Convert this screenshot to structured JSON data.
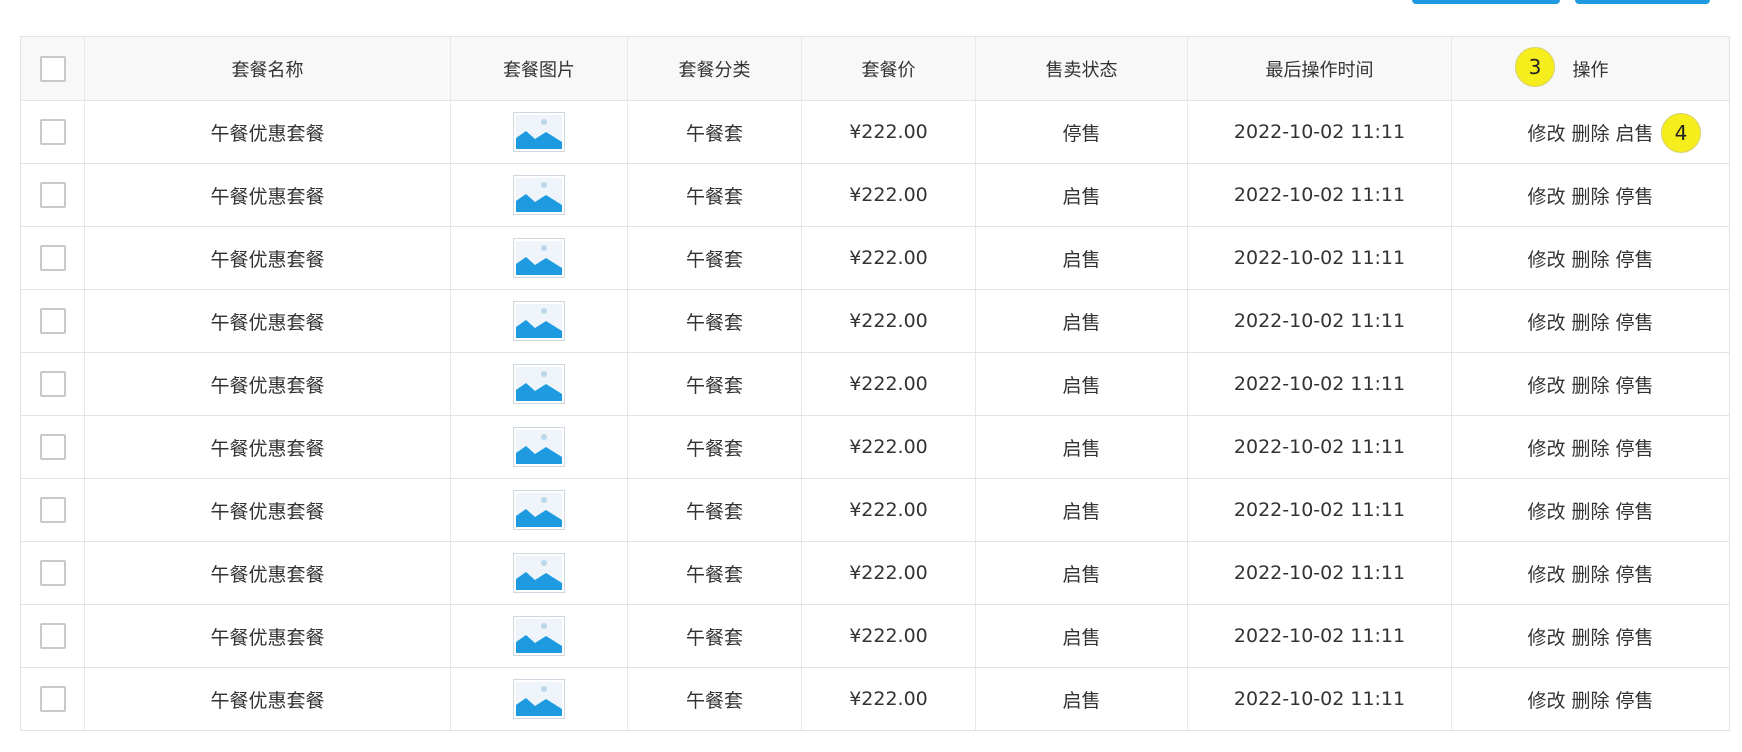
{
  "table": {
    "headers": {
      "name": "套餐名称",
      "image": "套餐图片",
      "category": "套餐分类",
      "price": "套餐价",
      "status": "售卖状态",
      "updated": "最后操作时间",
      "actions": "操作"
    },
    "rows": [
      {
        "name": "午餐优惠套餐",
        "category": "午餐套",
        "price": "¥222.00",
        "status": "停售",
        "updated": "2022-10-02 11:11",
        "edit": "修改",
        "delete": "删除",
        "toggle": "启售"
      },
      {
        "name": "午餐优惠套餐",
        "category": "午餐套",
        "price": "¥222.00",
        "status": "启售",
        "updated": "2022-10-02 11:11",
        "edit": "修改",
        "delete": "删除",
        "toggle": "停售"
      },
      {
        "name": "午餐优惠套餐",
        "category": "午餐套",
        "price": "¥222.00",
        "status": "启售",
        "updated": "2022-10-02 11:11",
        "edit": "修改",
        "delete": "删除",
        "toggle": "停售"
      },
      {
        "name": "午餐优惠套餐",
        "category": "午餐套",
        "price": "¥222.00",
        "status": "启售",
        "updated": "2022-10-02 11:11",
        "edit": "修改",
        "delete": "删除",
        "toggle": "停售"
      },
      {
        "name": "午餐优惠套餐",
        "category": "午餐套",
        "price": "¥222.00",
        "status": "启售",
        "updated": "2022-10-02 11:11",
        "edit": "修改",
        "delete": "删除",
        "toggle": "停售"
      },
      {
        "name": "午餐优惠套餐",
        "category": "午餐套",
        "price": "¥222.00",
        "status": "启售",
        "updated": "2022-10-02 11:11",
        "edit": "修改",
        "delete": "删除",
        "toggle": "停售"
      },
      {
        "name": "午餐优惠套餐",
        "category": "午餐套",
        "price": "¥222.00",
        "status": "启售",
        "updated": "2022-10-02 11:11",
        "edit": "修改",
        "delete": "删除",
        "toggle": "停售"
      },
      {
        "name": "午餐优惠套餐",
        "category": "午餐套",
        "price": "¥222.00",
        "status": "启售",
        "updated": "2022-10-02 11:11",
        "edit": "修改",
        "delete": "删除",
        "toggle": "停售"
      },
      {
        "name": "午餐优惠套餐",
        "category": "午餐套",
        "price": "¥222.00",
        "status": "启售",
        "updated": "2022-10-02 11:11",
        "edit": "修改",
        "delete": "删除",
        "toggle": "停售"
      },
      {
        "name": "午餐优惠套餐",
        "category": "午餐套",
        "price": "¥222.00",
        "status": "启售",
        "updated": "2022-10-02 11:11",
        "edit": "修改",
        "delete": "删除",
        "toggle": "停售"
      }
    ]
  },
  "annotations": {
    "badge_3": "3",
    "badge_4": "4"
  },
  "colors": {
    "accent": "#1e9be0",
    "badge": "#f6ee1c"
  },
  "icons": {
    "thumbnail": "image-placeholder-icon"
  }
}
